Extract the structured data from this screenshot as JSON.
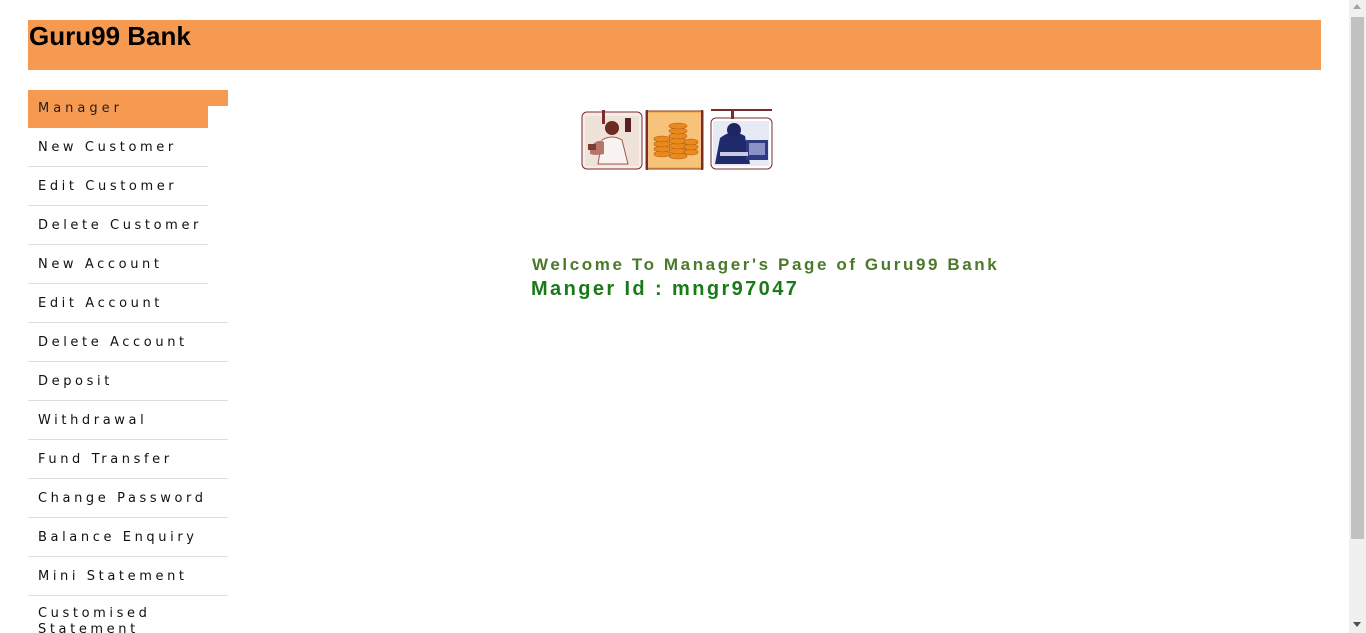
{
  "header": {
    "title": "Guru99 Bank",
    "bg_color": "#f79a51"
  },
  "sidebar": {
    "items": [
      {
        "label": "Manager"
      },
      {
        "label": "New Customer"
      },
      {
        "label": "Edit Customer"
      },
      {
        "label": "Delete Customer"
      },
      {
        "label": "New Account"
      },
      {
        "label": "Edit Account"
      },
      {
        "label": "Delete Account"
      },
      {
        "label": "Deposit"
      },
      {
        "label": "Withdrawal"
      },
      {
        "label": "Fund Transfer"
      },
      {
        "label": "Change Password"
      },
      {
        "label": "Balance Enquiry"
      },
      {
        "label": "Mini Statement"
      },
      {
        "label": "Customised Statement"
      }
    ]
  },
  "main": {
    "welcome_text": "Welcome To Manager's Page of Guru99 Bank",
    "manager_id_text": "Manger Id : mngr97047",
    "welcome_color": "#4a7a2a",
    "manager_id_color": "#1a7a1a"
  }
}
